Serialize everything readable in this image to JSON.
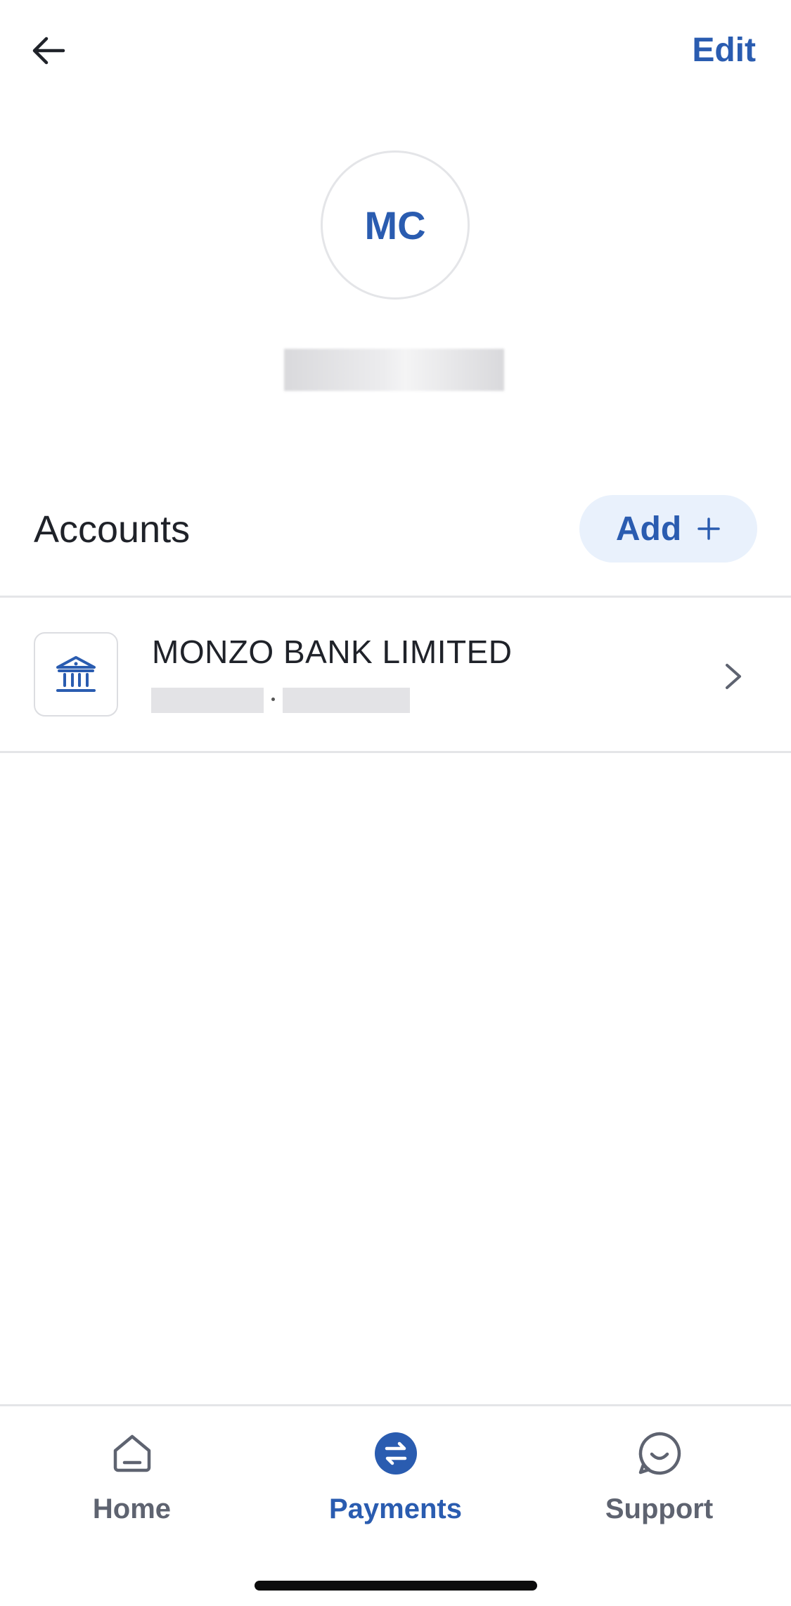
{
  "header": {
    "back_icon": "arrow-left-icon",
    "edit_label": "Edit"
  },
  "profile": {
    "initials": "MC",
    "name_redacted": true
  },
  "accounts": {
    "title": "Accounts",
    "add_label": "Add",
    "add_icon": "plus-icon",
    "items": [
      {
        "bank_name": "MONZO BANK LIMITED",
        "icon": "bank-icon",
        "details_redacted": true
      }
    ]
  },
  "tabbar": {
    "tabs": [
      {
        "label": "Home",
        "icon": "home-icon",
        "active": false
      },
      {
        "label": "Payments",
        "icon": "payments-icon",
        "active": true
      },
      {
        "label": "Support",
        "icon": "chat-icon",
        "active": false
      }
    ]
  },
  "colors": {
    "accent": "#2a5cb0",
    "add_button_bg": "#e9f1fc",
    "text_primary": "#1f2229",
    "text_muted": "#5e6370",
    "divider": "#e4e5e8"
  }
}
